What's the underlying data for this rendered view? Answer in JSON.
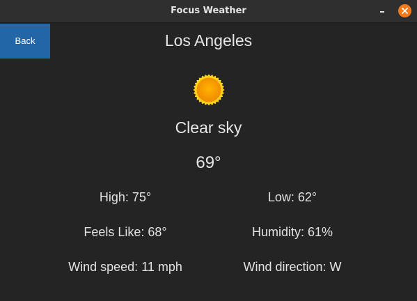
{
  "window": {
    "title": "Focus Weather"
  },
  "nav": {
    "back_label": "Back"
  },
  "weather": {
    "city": "Los Angeles",
    "icon": "sun-icon",
    "condition": "Clear sky",
    "temperature": "69°",
    "high_label": "High:",
    "high_value": "75°",
    "low_label": "Low:",
    "low_value": "62°",
    "feels_like_label": "Feels Like:",
    "feels_like_value": "68°",
    "humidity_label": "Humidity:",
    "humidity_value": "61%",
    "wind_speed_label": "Wind speed:",
    "wind_speed_value": "11 mph",
    "wind_direction_label": "Wind direction:",
    "wind_direction_value": "W"
  },
  "colors": {
    "background": "#242424",
    "titlebar": "#2f2f2f",
    "back_button": "#2266a8",
    "close_button": "#f27a1b",
    "sun": "#f5a300",
    "sun_rim": "#ffd400"
  }
}
